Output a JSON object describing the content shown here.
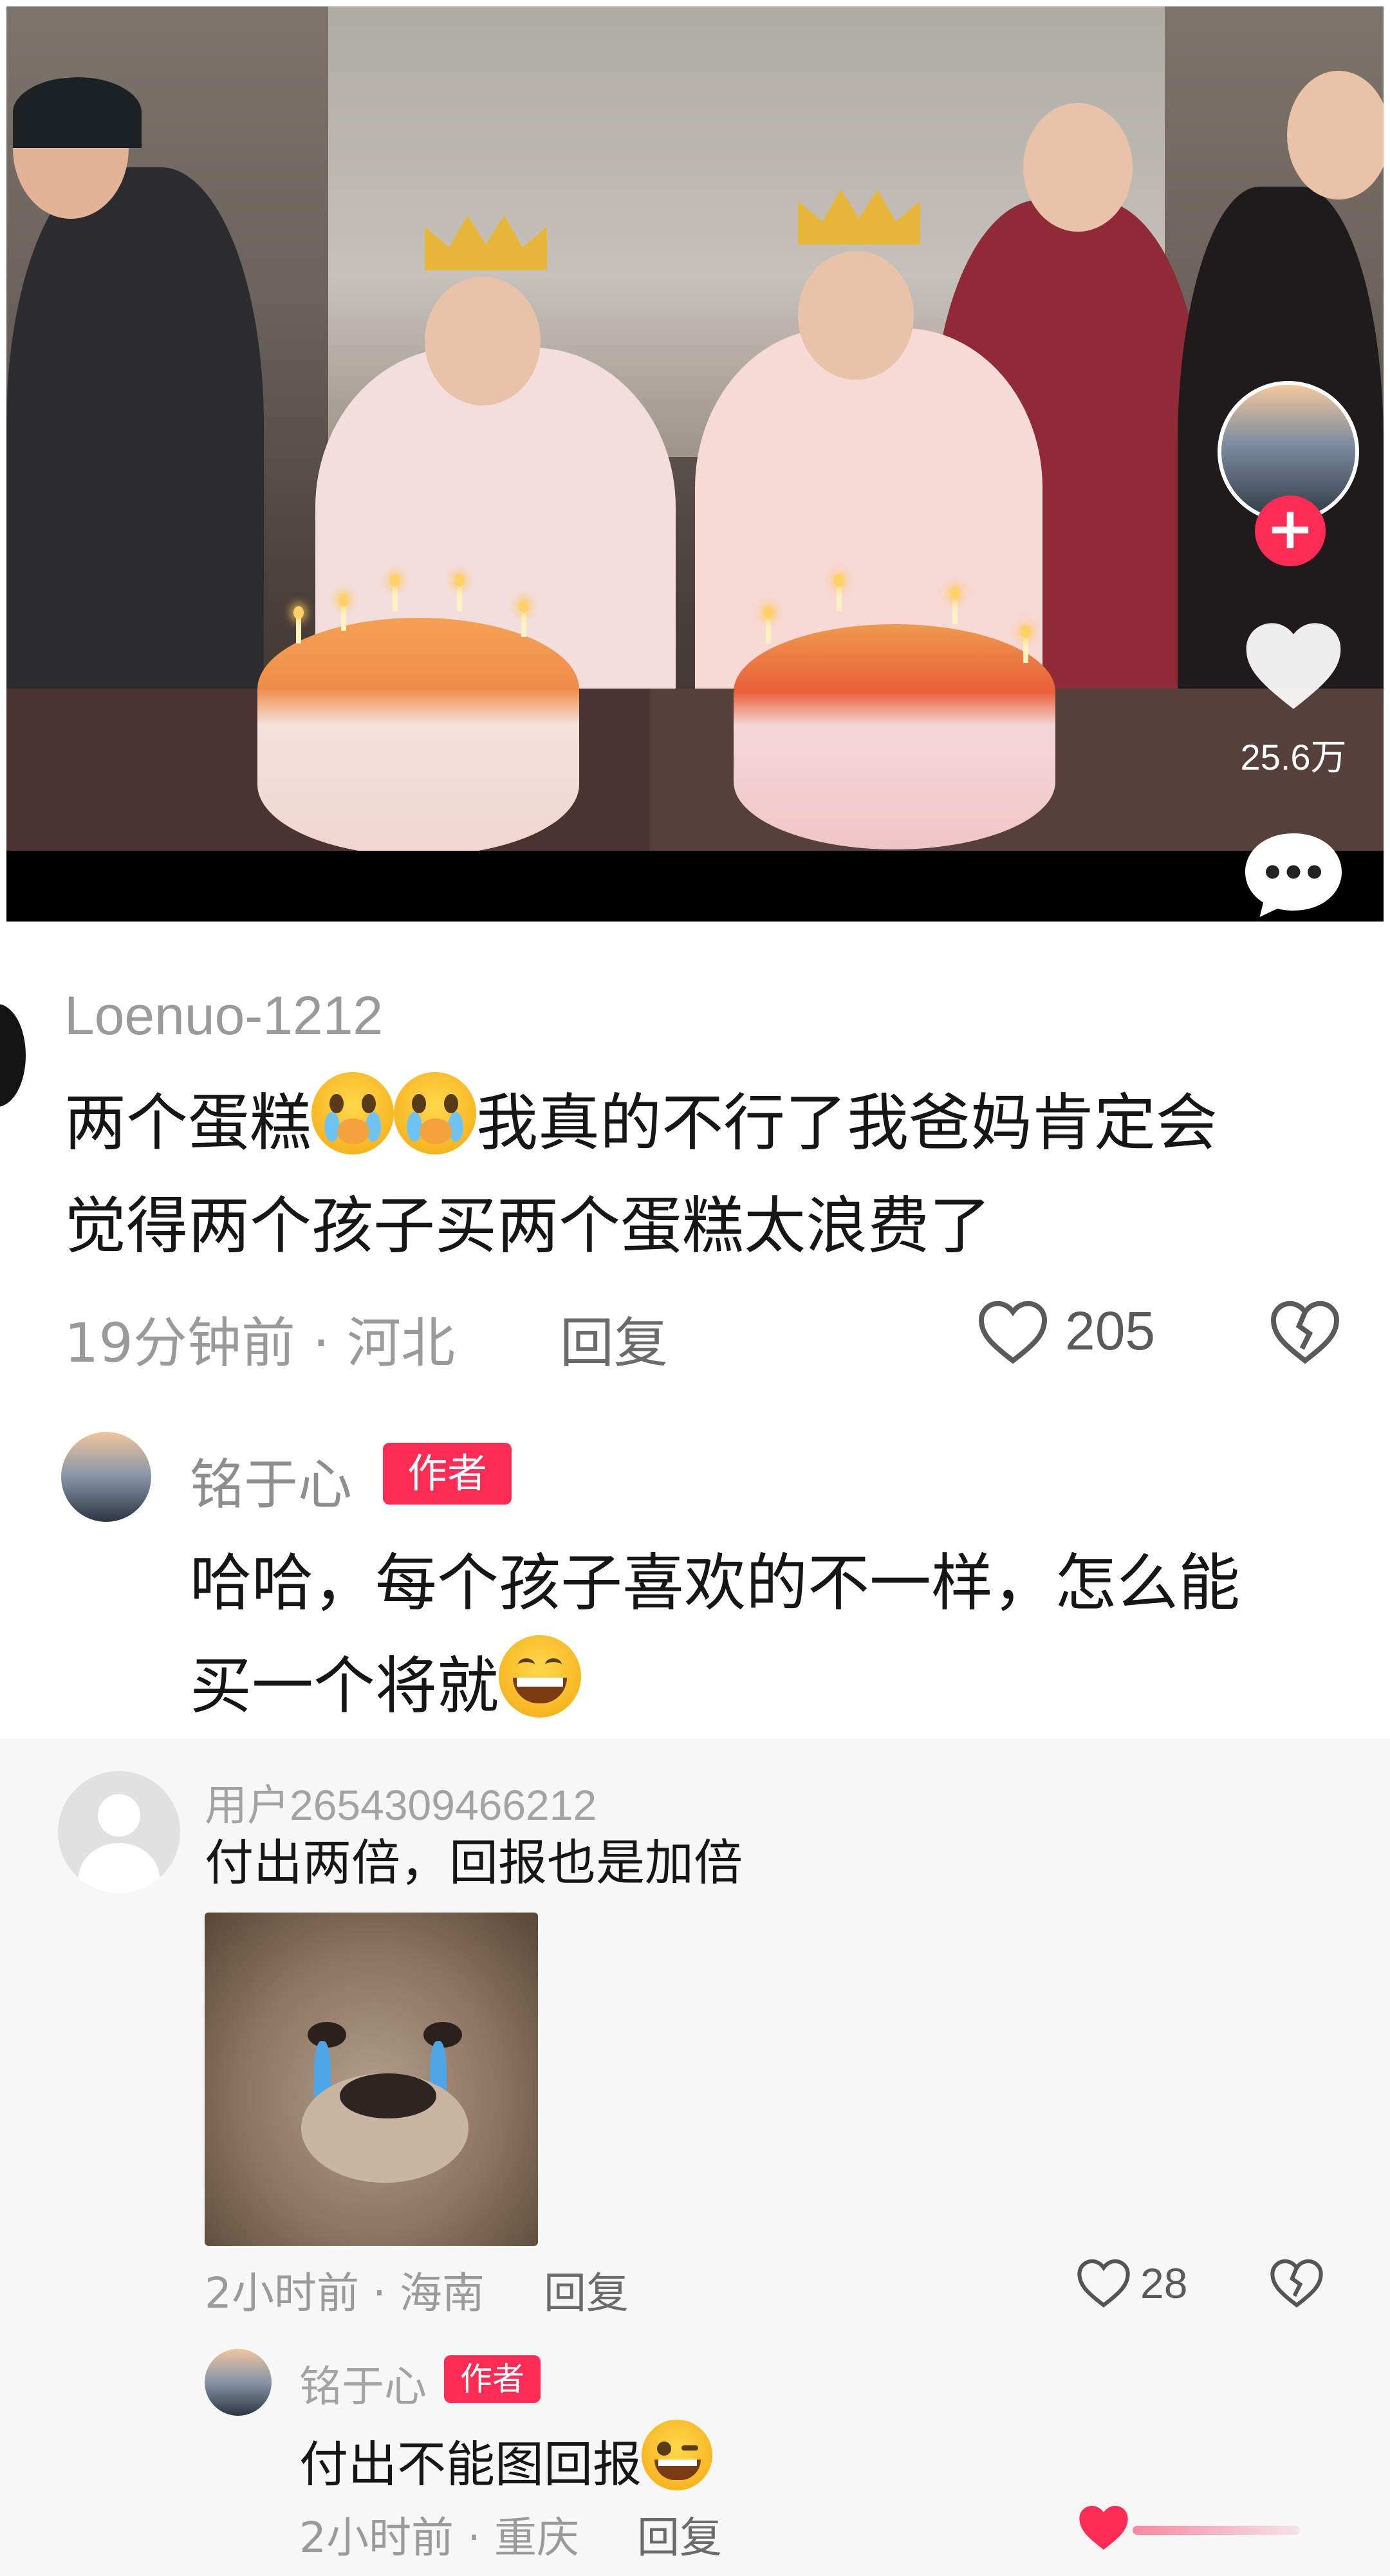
{
  "video": {
    "like_count": "25.6万"
  },
  "comments": [
    {
      "username": "Loenuo-1212",
      "text_line1_a": "两个蛋糕",
      "text_line1_b": "我真的不行了我爸妈肯定会",
      "text_line2": "觉得两个孩子买两个蛋糕太浪费了",
      "meta": "19分钟前 · 河北",
      "reply_label": "回复",
      "like_count": "205",
      "reply": {
        "username": "铭于心",
        "badge": "作者",
        "text_line1": "哈哈，每个孩子喜欢的不一样，怎么能",
        "text_line2": "买一个将就"
      }
    },
    {
      "username": "用户2654309466212",
      "text": "付出两倍，回报也是加倍",
      "meta": "2小时前 · 海南",
      "reply_label": "回复",
      "like_count": "28",
      "reply": {
        "username": "铭于心",
        "badge": "作者",
        "text": "付出不能图回报",
        "meta": "2小时前 · 重庆",
        "reply_label": "回复"
      }
    }
  ],
  "colors": {
    "accent": "#fe2c55",
    "meta_text": "#9a9a9a"
  },
  "icons": [
    "plus-icon",
    "heart-icon",
    "comment-icon",
    "dislike-icon",
    "crying-emoji-icon",
    "grin-emoji-icon",
    "wink-emoji-icon",
    "default-avatar-icon"
  ]
}
